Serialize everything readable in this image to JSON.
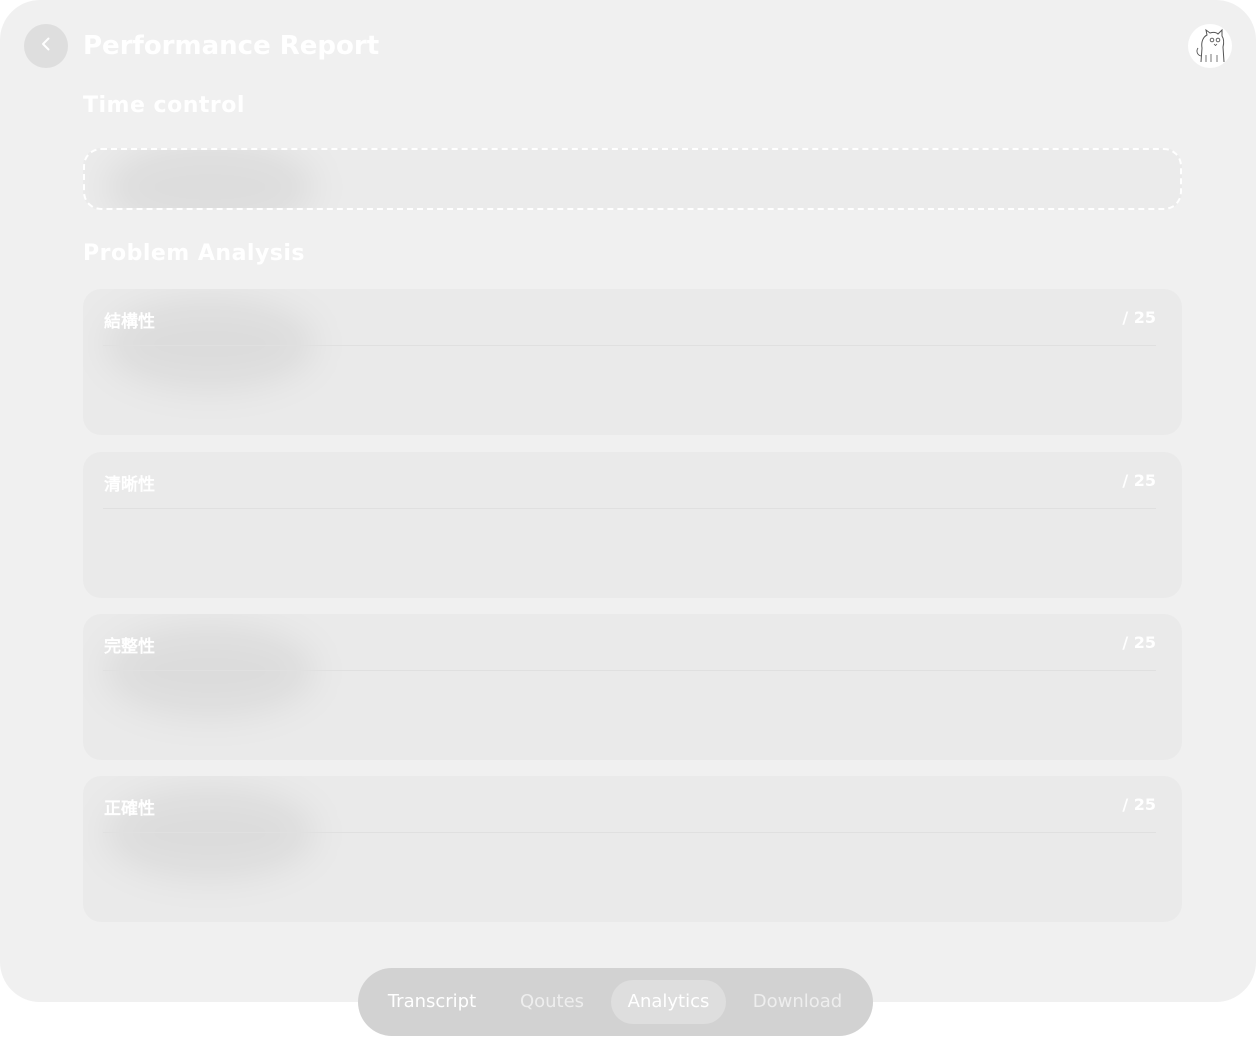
{
  "header": {
    "title": "Performance Report",
    "back_icon": "chevron-left-icon",
    "avatar_icon": "cat-sketch-icon"
  },
  "time_control": {
    "heading": "Time control"
  },
  "problem_analysis": {
    "heading": "Problem Analysis",
    "cards": [
      {
        "label": "結構性",
        "score": "/ 25"
      },
      {
        "label": "清晰性",
        "score": "/ 25"
      },
      {
        "label": "完整性",
        "score": "/ 25"
      },
      {
        "label": "正確性",
        "score": "/ 25"
      }
    ]
  },
  "tabs": [
    {
      "label": "Transcript",
      "active": false,
      "color": "#ffffff"
    },
    {
      "label": "Qoutes",
      "active": false,
      "color": "#eeeeee"
    },
    {
      "label": "Analytics",
      "active": true,
      "color": "#ffffff"
    },
    {
      "label": "Download",
      "active": false,
      "color": "#eeeeee"
    }
  ],
  "colors": {
    "panel_bg": "#f0f0f0",
    "card_bg": "#eaeaea",
    "tabbar_bg": "#d2d2d2",
    "text": "#ffffff"
  }
}
